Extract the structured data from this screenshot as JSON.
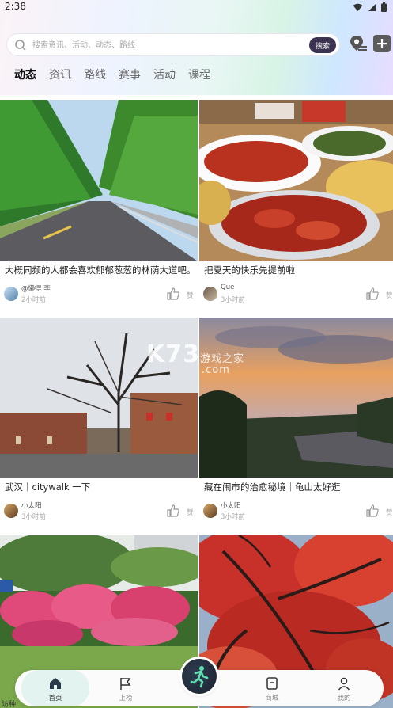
{
  "status_bar": {
    "time": "2:38"
  },
  "search": {
    "placeholder": "搜索资讯、活动、动态、路线",
    "button_label": "搜索"
  },
  "tabs": [
    {
      "label": "动态",
      "active": true
    },
    {
      "label": "资讯",
      "active": false
    },
    {
      "label": "路线",
      "active": false
    },
    {
      "label": "赛事",
      "active": false
    },
    {
      "label": "活动",
      "active": false
    },
    {
      "label": "课程",
      "active": false
    }
  ],
  "feed": [
    {
      "title": "大概同频的人都会喜欢郁郁葱葱的林荫大道吧。",
      "author": "@懒得 李",
      "time": "2小时前",
      "like_label": "赞"
    },
    {
      "title": "把夏天的快乐先提前啦",
      "author": "Que",
      "time": "3小时前",
      "like_label": "赞"
    },
    {
      "title": "武汉｜citywalk 一下",
      "author": "小太阳",
      "time": "3小时前",
      "like_label": "赞"
    },
    {
      "title": "藏在闹市的治愈秘境｜龟山太好逛",
      "author": "小太阳",
      "time": "3小时前",
      "like_label": "赞"
    }
  ],
  "bottom_partial": {
    "left_text": "访种"
  },
  "watermark": {
    "main": "K73",
    "sub": "游戏之家",
    "domain": ".com"
  },
  "bottom_nav": {
    "home": "首页",
    "post": "上榜",
    "shop": "商城",
    "mine": "我的"
  },
  "colors": {
    "accent": "#7ed8b8",
    "search_button": "#3b3350",
    "nav_active": "#e3f4f0"
  }
}
